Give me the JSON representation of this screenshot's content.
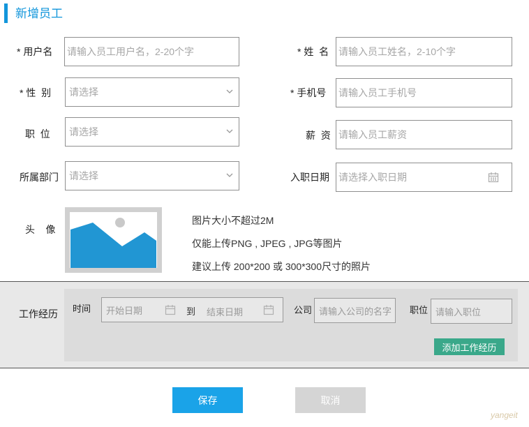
{
  "title": "新增员工",
  "form": {
    "username": {
      "label": "* 用户名",
      "placeholder": "请输入员工用户名，2-20个字"
    },
    "name": {
      "label": "* 姓  名",
      "placeholder": "请输入员工姓名，2-10个字"
    },
    "gender": {
      "label": "* 性  别",
      "placeholder": "请选择"
    },
    "phone": {
      "label": "* 手机号",
      "placeholder": "请输入员工手机号"
    },
    "position": {
      "label": "职  位",
      "placeholder": "请选择"
    },
    "salary": {
      "label": "薪  资",
      "placeholder": "请输入员工薪资"
    },
    "department": {
      "label": "所属部门",
      "placeholder": "请选择"
    },
    "hire_date": {
      "label": "入职日期",
      "placeholder": "请选择入职日期"
    },
    "avatar": {
      "label": "头    像",
      "hints": [
        "图片大小不超过2M",
        "仅能上传PNG , JPEG , JPG等图片",
        "建议上传 200*200 或 300*300尺寸的照片"
      ]
    }
  },
  "work": {
    "label": "工作经历",
    "time_label": "时间",
    "start_placeholder": "开始日期",
    "to_label": "到",
    "end_placeholder": "结束日期",
    "company_label": "公司",
    "company_placeholder": "请输入公司的名字",
    "job_label": "职位",
    "job_placeholder": "请输入职位",
    "add_button": "添加工作经历"
  },
  "buttons": {
    "save": "保存",
    "cancel": "取消"
  },
  "watermark": "yangeit",
  "colors": {
    "accent": "#1296db",
    "save": "#1aa3e8",
    "add": "#3aa88a",
    "cancel": "#d5d5d5"
  },
  "icons": {
    "select": "chevron-down-icon",
    "date": "calendar-icon",
    "avatar": "image-placeholder-icon"
  }
}
